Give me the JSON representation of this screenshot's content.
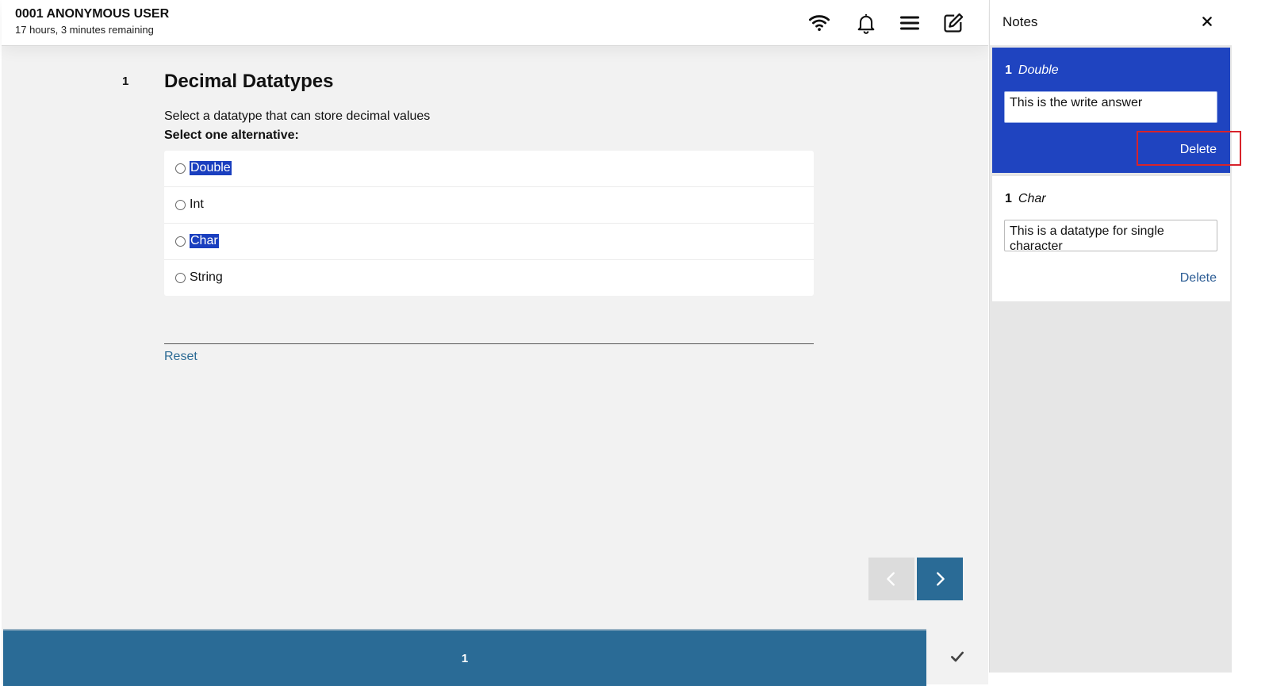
{
  "header": {
    "user_name": "0001 ANONYMOUS USER",
    "time_remaining": "17 hours, 3 minutes remaining",
    "icons": [
      "wifi-icon",
      "bell-icon",
      "menu-icon",
      "edit-icon"
    ]
  },
  "question": {
    "number": "1",
    "title": "Decimal Datatypes",
    "prompt": "Select a datatype that can store decimal values",
    "instruction": "Select one alternative:",
    "options": [
      {
        "label": "Double",
        "highlighted": true
      },
      {
        "label": "Int",
        "highlighted": false
      },
      {
        "label": "Char",
        "highlighted": true
      },
      {
        "label": "String",
        "highlighted": false
      }
    ],
    "reset_label": "Reset"
  },
  "footer": {
    "page_number": "1"
  },
  "notes": {
    "title": "Notes",
    "items": [
      {
        "question_number": "1",
        "option": "Double",
        "text": "This is the write answer",
        "delete_label": "Delete"
      },
      {
        "question_number": "1",
        "option": "Char",
        "text": "This is a datatype for single character",
        "delete_label": "Delete"
      }
    ]
  },
  "colors": {
    "primary": "#2a6b96",
    "note_active": "#1f44c0",
    "highlight_box": "#d8232a"
  }
}
